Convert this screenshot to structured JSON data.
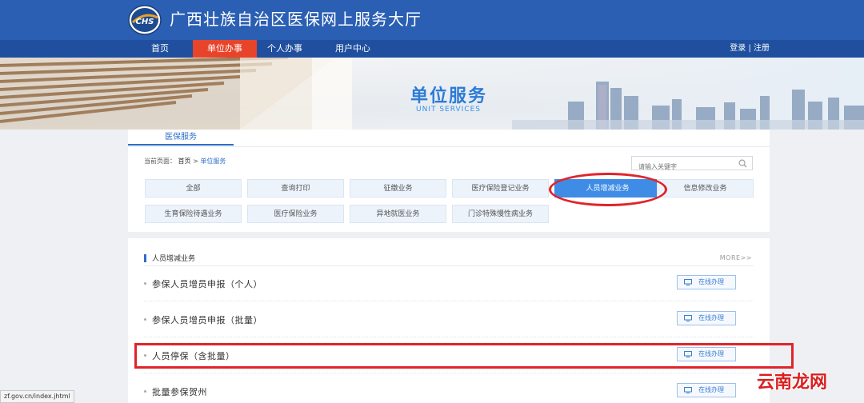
{
  "header": {
    "logo_text": "CHS",
    "site_title": "广西壮族自治区医保网上服务大厅"
  },
  "nav": {
    "items": [
      {
        "label": "首页",
        "active": false
      },
      {
        "label": "单位办事",
        "active": true
      },
      {
        "label": "个人办事",
        "active": false
      },
      {
        "label": "用户中心",
        "active": false
      }
    ],
    "login_register": "登录 | 注册"
  },
  "banner": {
    "title": "单位服务",
    "subtitle": "UNIT SERVICES"
  },
  "service_panel": {
    "tab": "医保服务",
    "breadcrumb": {
      "prefix": "当前页面：",
      "home": "首页",
      "separator": ">",
      "current": "单位服务"
    },
    "search": {
      "placeholder": "请输入关键字"
    },
    "categories": [
      {
        "label": "全部"
      },
      {
        "label": "查询打印"
      },
      {
        "label": "征缴业务"
      },
      {
        "label": "医疗保险登记业务"
      },
      {
        "label": "人员增减业务",
        "active": true
      },
      {
        "label": "信息修改业务"
      },
      {
        "label": "生育保险待遇业务"
      },
      {
        "label": "医疗保险业务"
      },
      {
        "label": "异地就医业务"
      },
      {
        "label": "门诊特殊慢性病业务"
      }
    ]
  },
  "business_list": {
    "section_title": "人员增减业务",
    "more": "MORE>>",
    "button_label": "在线办理",
    "rows": [
      {
        "title": "参保人员增员申报（个人）"
      },
      {
        "title": "参保人员增员申报（批量）"
      },
      {
        "title": "人员停保（含批量）"
      },
      {
        "title": "批量参保贺州"
      }
    ]
  },
  "status_url": "zf.gov.cn/index.jhtml",
  "watermark": "云南龙网",
  "colors": {
    "header_blue": "#2a5fb3",
    "nav_blue": "#1f4f9e",
    "nav_active": "#e8442a",
    "accent_blue": "#3f8ce6",
    "highlight_red": "#e0242a"
  }
}
